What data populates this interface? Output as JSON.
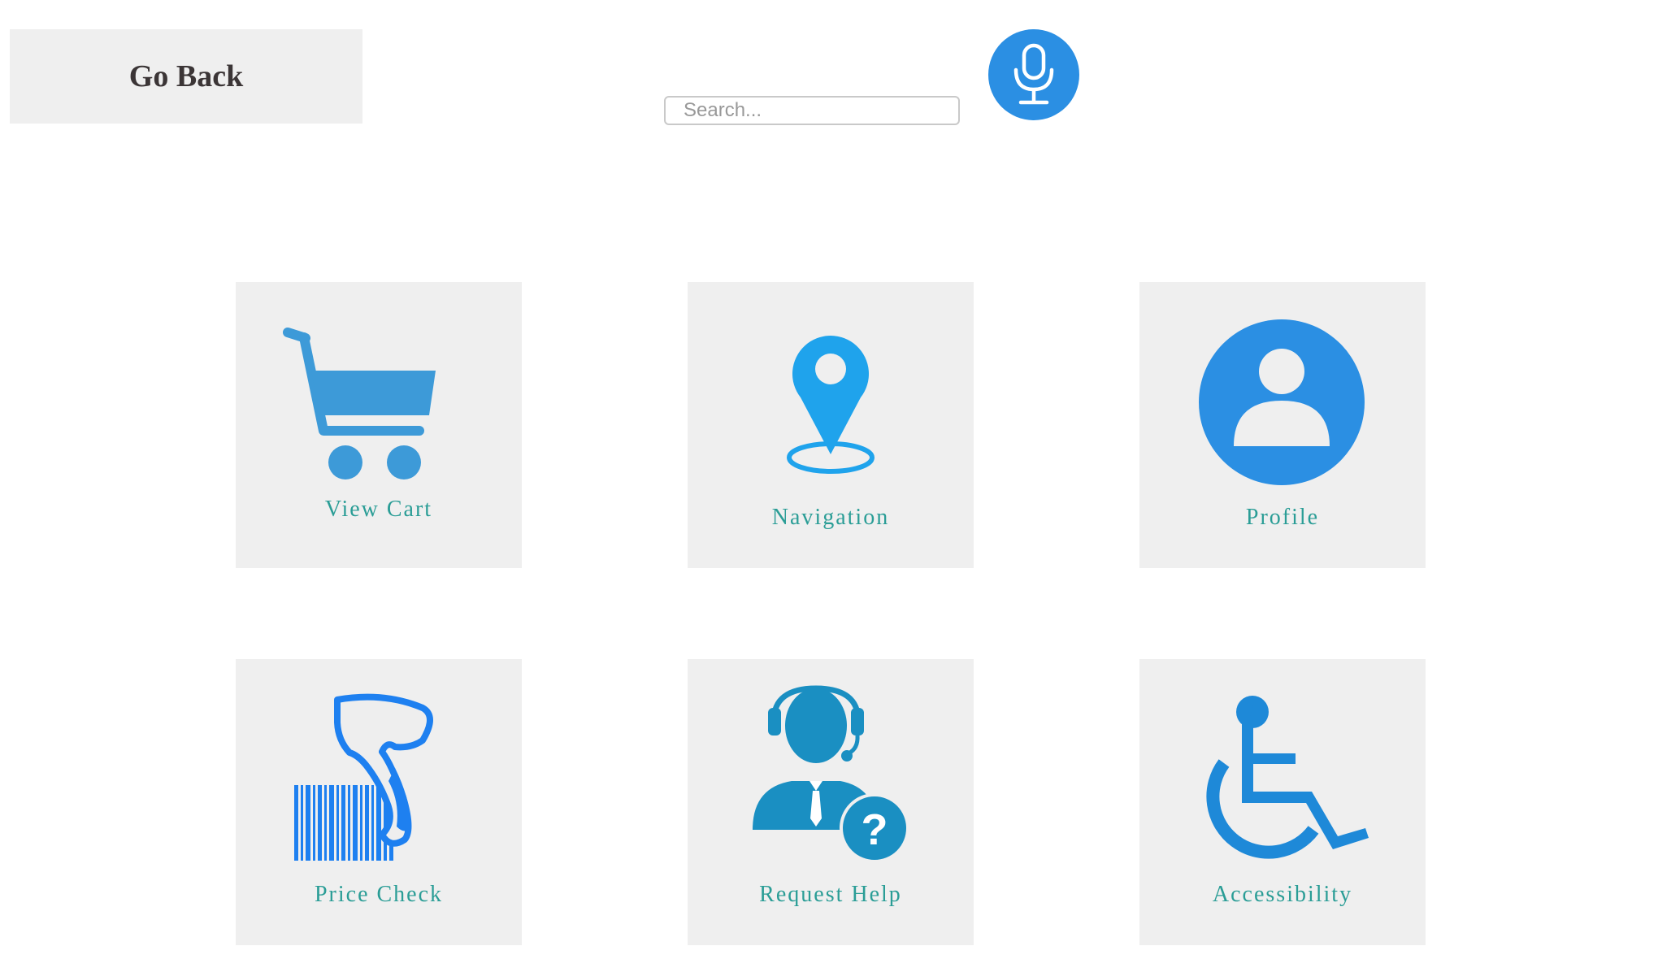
{
  "header": {
    "go_back_label": "Go Back",
    "search": {
      "placeholder": "Search...",
      "value": ""
    },
    "mic_icon": "microphone-icon"
  },
  "tiles": [
    {
      "label": "View Cart",
      "icon": "shopping-cart-icon"
    },
    {
      "label": "Navigation",
      "icon": "location-pin-icon"
    },
    {
      "label": "Profile",
      "icon": "user-profile-icon"
    },
    {
      "label": "Price Check",
      "icon": "barcode-scanner-icon"
    },
    {
      "label": "Request Help",
      "icon": "support-agent-icon"
    },
    {
      "label": "Accessibility",
      "icon": "wheelchair-icon"
    }
  ],
  "colors": {
    "primary_blue": "#2b8fe3",
    "label_teal": "#2a9d96",
    "tile_background": "#efefef",
    "go_back_text": "#3b3536"
  }
}
